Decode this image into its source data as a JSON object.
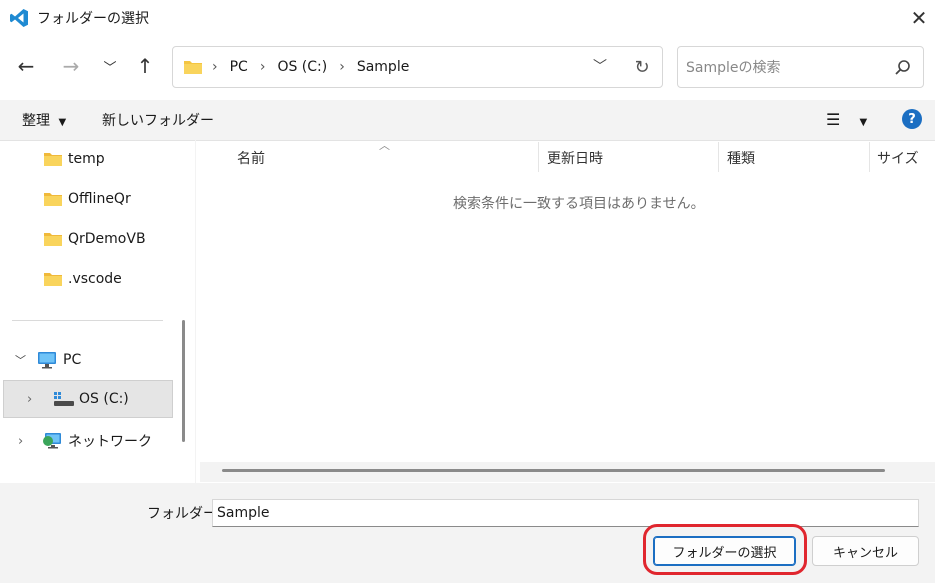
{
  "window": {
    "title": "フォルダーの選択",
    "app_icon": "vscode-icon",
    "close_icon": "close-icon"
  },
  "nav": {
    "back": "back-arrow-icon",
    "forward": "forward-arrow-icon",
    "recent": "chevron-down-icon",
    "up": "up-arrow-icon"
  },
  "address": {
    "breadcrumbs": [
      "PC",
      "OS (C:)",
      "Sample"
    ],
    "separator": "›"
  },
  "search": {
    "placeholder": "Sampleの検索",
    "value": ""
  },
  "toolbar": {
    "organize_label": "整理",
    "new_folder_label": "新しいフォルダー"
  },
  "sidebar": {
    "folders": [
      {
        "label": "temp"
      },
      {
        "label": "OfflineQr"
      },
      {
        "label": "QrDemoVB"
      },
      {
        "label": ".vscode"
      }
    ],
    "pc_label": "PC",
    "drive_label": "OS (C:)",
    "network_label": "ネットワーク"
  },
  "file_list": {
    "columns": [
      "名前",
      "更新日時",
      "種類",
      "サイズ"
    ],
    "empty_message": "検索条件に一致する項目はありません。"
  },
  "footer": {
    "folder_label": "フォルダー:",
    "folder_value": "Sample",
    "select_button": "フォルダーの選択",
    "cancel_button": "キャンセル"
  },
  "colors": {
    "accent": "#1b6ec2",
    "highlight": "#e0262e",
    "folder": "#f4c542"
  }
}
